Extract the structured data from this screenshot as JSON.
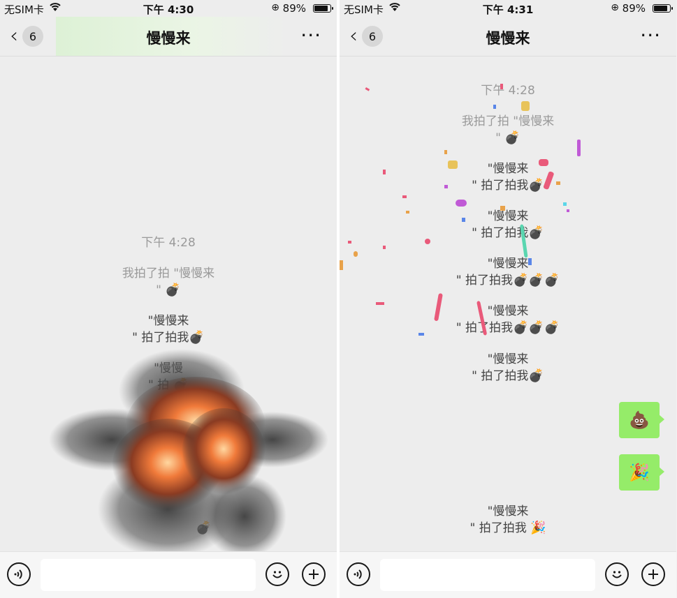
{
  "status_left": {
    "carrier": "无SIM卡",
    "time": "下午 4:30",
    "battery": "89%",
    "battery_level": 0.89
  },
  "status_right": {
    "carrier": "无SIM卡",
    "time": "下午 4:31",
    "battery": "89%",
    "battery_level": 0.89
  },
  "nav": {
    "badge_count": "6",
    "title": "慢慢来",
    "more": "···"
  },
  "left_messages": {
    "timestamp": "下午 4:28",
    "m1_line1": "我拍了拍 \"慢慢来",
    "m1_line2": "\"",
    "m1_emoji": "💣",
    "m2_line1": "\"慢慢来",
    "m2_line2": "\" 拍了拍我",
    "m2_emoji": "💣",
    "m3_line1": "\"慢慢",
    "m3_line2": "\" 拍",
    "m3_emoji": "💣",
    "m4_emoji": "💣"
  },
  "right_messages": {
    "timestamp": "下午 4:28",
    "m1_line1": "我拍了拍 \"慢慢来",
    "m1_line2": "\"",
    "m1_emoji": "💣",
    "m2_line1": "\"慢慢来",
    "m2_line2": "\" 拍了拍我",
    "m2_emoji": "💣",
    "m3_line1": "\"慢慢来",
    "m3_line2": "\" 拍了拍我",
    "m3_emoji": "💣",
    "m4_line1": "\"慢慢来",
    "m4_line2": "\" 拍了拍我",
    "m4_emoji": "💣💣💣",
    "m5_line1": "\"慢慢来",
    "m5_line2": "\" 拍了拍我",
    "m5_emoji": "💣💣💣",
    "m6_line1": "\"慢慢来",
    "m6_line2": "\" 拍了拍我",
    "m6_emoji": "💣",
    "bubble1": "💩",
    "bubble2": "🎉",
    "m7_line1": "\"慢慢来",
    "m7_line2": "\" 拍了拍我",
    "m7_emoji": "🎉"
  },
  "input_bar": {
    "voice_icon": "voice-icon",
    "emoji_icon": "emoji-icon",
    "plus_icon": "plus-icon",
    "text": ""
  },
  "colors": {
    "bubble": "#95ec69",
    "background": "#ededed",
    "system_text": "#9a9a9a"
  }
}
